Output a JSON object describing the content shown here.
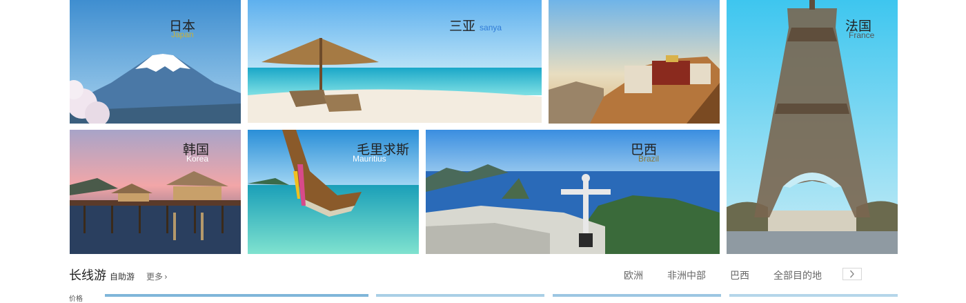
{
  "tiles": {
    "japan": {
      "zh": "日本",
      "en": "Japan",
      "en_color": "#c9b23a"
    },
    "sanya": {
      "zh": "三亚",
      "en": "sanya",
      "en_color": "#2f7bd6"
    },
    "tibet": {
      "zh": "",
      "en": ""
    },
    "france": {
      "zh": "法国",
      "en": "France",
      "en_color": "#555555"
    },
    "korea": {
      "zh": "韩国",
      "en": "Korea",
      "en_color": "#ffffff"
    },
    "mauritius": {
      "zh": "毛里求斯",
      "en": "Mauritius",
      "en_color": "#ffffff"
    },
    "brazil": {
      "zh": "巴西",
      "en": "Brazil",
      "en_color": "#8a7a3a"
    }
  },
  "section": {
    "title": "长线游",
    "subtitle": "自助游",
    "more_label": "更多",
    "more_icon": "chevron-right-icon",
    "tabs": [
      "欧洲",
      "非洲中部",
      "巴西",
      "全部目的地"
    ],
    "next_icon": "chevron-right-icon",
    "cut_text": "价格"
  }
}
